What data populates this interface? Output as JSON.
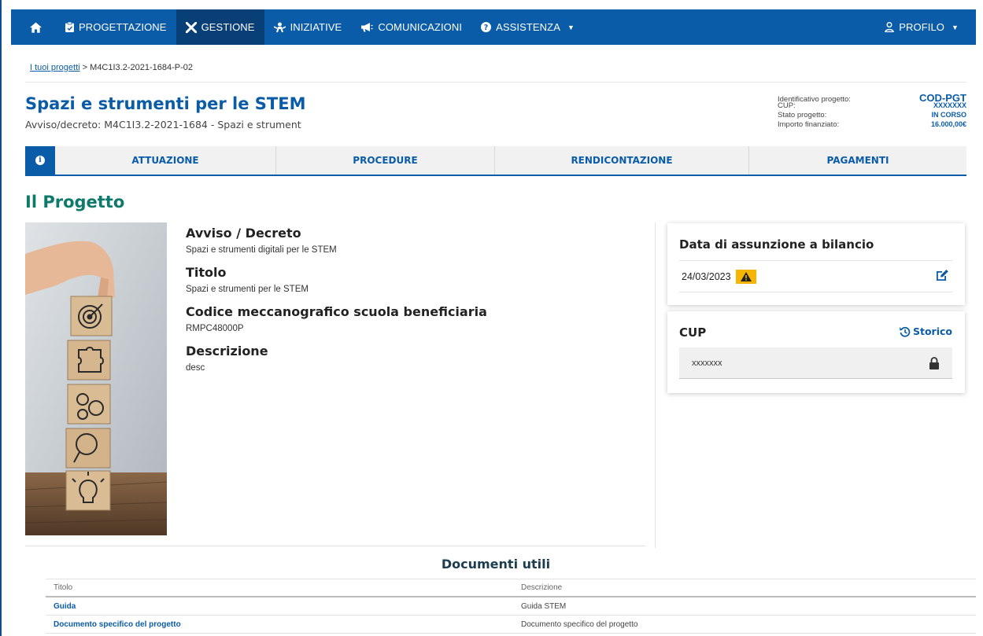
{
  "navbar": {
    "items": [
      {
        "label": "PROGETTAZIONE",
        "icon": "clipboard-icon"
      },
      {
        "label": "GESTIONE",
        "icon": "tools-icon"
      },
      {
        "label": "INIZIATIVE",
        "icon": "people-icon"
      },
      {
        "label": "COMUNICAZIONI",
        "icon": "megaphone-icon"
      },
      {
        "label": "ASSISTENZA",
        "icon": "question-icon"
      }
    ],
    "profile_label": "PROFILO",
    "active": "GESTIONE",
    "color": "#0b5ca8"
  },
  "breadcrumb": {
    "link": "I tuoi progetti",
    "separator": ">",
    "current": "M4C1I3.2-2021-1684-P-02"
  },
  "header": {
    "title": "Spazi e strumenti per le STEM",
    "subtitle": "Avviso/decreto: M4C1I3.2-2021-1684 - Spazi e strument"
  },
  "project_info": {
    "id_label": "Identificativo progetto:",
    "id_value": "COD-PGT",
    "cup_label": "CUP:",
    "cup_value": "XXXXXXX",
    "status_label": "Stato progetto:",
    "status_value": "IN CORSO",
    "amount_label": "Importo finanziato:",
    "amount_value": "16.000,00€"
  },
  "tabs": [
    "ATTUAZIONE",
    "PROCEDURE",
    "RENDICONTAZIONE",
    "PAGAMENTI"
  ],
  "section": {
    "title": "Il Progetto"
  },
  "details": {
    "avviso_label": "Avviso / Decreto",
    "avviso_value": "Spazi e strumenti digitali per le STEM",
    "titolo_label": "Titolo",
    "titolo_value": "Spazi e strumenti per le STEM",
    "codice_label": "Codice meccanografico scuola beneficiaria",
    "codice_value": "RMPC48000P",
    "descrizione_label": "Descrizione",
    "descrizione_value": "desc"
  },
  "bilancio_card": {
    "title": "Data di assunzione a bilancio",
    "date": "24/03/2023"
  },
  "cup_card": {
    "title": "CUP",
    "storico_label": "Storico",
    "value": "xxxxxxx"
  },
  "documents": {
    "title": "Documenti utili",
    "headers": [
      "Titolo",
      "Descrizione"
    ],
    "rows": [
      {
        "title": "Guida",
        "description": "Guida STEM"
      },
      {
        "title": "Documento specifico del progetto",
        "description": "Documento specifico del progetto"
      }
    ]
  }
}
